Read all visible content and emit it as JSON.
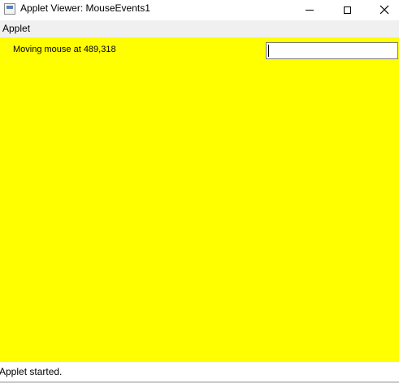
{
  "window": {
    "title": "Applet Viewer: MouseEvents1",
    "app_icon": "java-applet-icon",
    "controls": {
      "minimize_icon": "minimize-icon",
      "maximize_icon": "maximize-icon",
      "close_icon": "close-icon",
      "close_glyph": "✕"
    }
  },
  "menubar": {
    "items": [
      {
        "label": "Applet"
      }
    ]
  },
  "applet": {
    "background_color": "#ffff00",
    "message": "Moving mouse at 489,318",
    "text_field_value": ""
  },
  "status_bar": {
    "text": "Applet started."
  }
}
